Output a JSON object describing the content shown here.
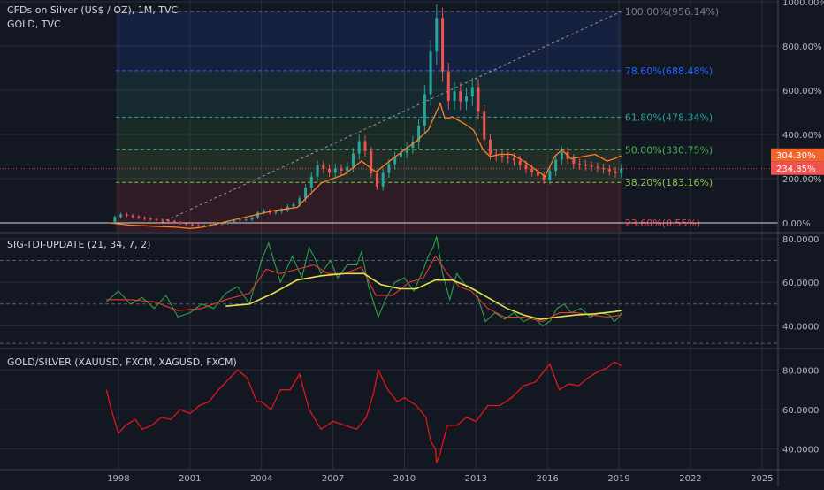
{
  "colors": {
    "background": "#131722",
    "grid": "#2a2e39",
    "silver_candle_up": "#26a69a",
    "silver_candle_down": "#ef5350",
    "gold_line": "#ff7f27",
    "tdi_green": "#2ea043",
    "tdi_red": "#e53935",
    "tdi_yellow": "#e6e04c",
    "ratio_line": "#e0171b",
    "badge_gold": "#f0642d",
    "badge_silver": "#ef5350"
  },
  "pane1": {
    "title": "CFDs on Silver (US$ / OZ), 1M, TVC",
    "subtitle": "GOLD, TVC",
    "badge_gold_value": "304.30%",
    "badge_silver_value": "234.85%"
  },
  "pane2": {
    "title": "SIG-TDI-UPDATE (21, 34, 7, 2)"
  },
  "pane3": {
    "title": "GOLD/SILVER (XAUUSD, FXCM, XAGUSD, FXCM)"
  },
  "chart_data": [
    {
      "type": "line",
      "name": "price-percent",
      "x_unit": "year",
      "xlim": [
        1996.0,
        2025.6
      ],
      "ylim": [
        -40,
        1000
      ],
      "y_ticks": [
        "0.00%",
        "200.00%",
        "400.00%",
        "600.00%",
        "800.00%",
        "1000.00%"
      ],
      "x_ticks": [
        "1998",
        "2001",
        "2004",
        "2007",
        "2010",
        "2013",
        "2016",
        "2019",
        "2022",
        "2025"
      ],
      "fibonacci_levels": [
        {
          "label": "100.00%(956.14%)",
          "value": 956.14,
          "color": "#787b86"
        },
        {
          "label": "78.60%(688.48%)",
          "value": 688.48,
          "color": "#2962ff"
        },
        {
          "label": "61.80%(478.34%)",
          "value": 478.34,
          "color": "#2ea09a"
        },
        {
          "label": "50.00%(330.75%)",
          "value": 330.75,
          "color": "#4caf50"
        },
        {
          "label": "38.20%(183.16%)",
          "value": 183.16,
          "color": "#8bc34a"
        },
        {
          "label": "23.60%(0.55%)",
          "value": 0.55,
          "color": "#f23645"
        }
      ],
      "series": [
        {
          "name": "CFDs on Silver (US$ / OZ)",
          "x": [
            1997.6,
            1998.0,
            1998.5,
            1999.0,
            1999.5,
            2000.0,
            2000.5,
            2001.0,
            2001.5,
            2002.0,
            2002.5,
            2003.0,
            2003.5,
            2004.0,
            2004.3,
            2004.8,
            2005.0,
            2005.5,
            2006.0,
            2006.4,
            2006.8,
            2007.0,
            2007.5,
            2008.0,
            2008.2,
            2008.5,
            2008.8,
            2009.0,
            2009.5,
            2010.0,
            2010.5,
            2010.8,
            2011.0,
            2011.2,
            2011.33,
            2011.5,
            2011.7,
            2011.9,
            2012.0,
            2012.2,
            2012.5,
            2012.75,
            2013.0,
            2013.3,
            2013.6,
            2014.0,
            2014.5,
            2015.0,
            2015.5,
            2015.9,
            2016.3,
            2016.6,
            2017.0,
            2017.5,
            2018.0,
            2018.5,
            2018.8,
            2019.0,
            2019.1
          ],
          "y": [
            5,
            40,
            30,
            20,
            15,
            10,
            0,
            -10,
            -15,
            -5,
            0,
            15,
            15,
            60,
            45,
            55,
            70,
            90,
            190,
            270,
            220,
            250,
            230,
            350,
            390,
            260,
            150,
            210,
            290,
            330,
            380,
            560,
            650,
            900,
            950,
            750,
            620,
            530,
            610,
            580,
            520,
            650,
            560,
            390,
            310,
            300,
            290,
            250,
            220,
            190,
            280,
            320,
            270,
            260,
            250,
            240,
            220,
            235,
            245
          ]
        },
        {
          "name": "GOLD",
          "x": [
            1997.6,
            1998.5,
            1999.5,
            2000.5,
            2001.0,
            2001.5,
            2002.5,
            2003.5,
            2004.5,
            2005.5,
            2006.5,
            2007.5,
            2008.2,
            2008.8,
            2009.5,
            2010.5,
            2011.0,
            2011.5,
            2011.7,
            2012.0,
            2012.5,
            2012.9,
            2013.3,
            2013.6,
            2014.0,
            2014.5,
            2015.0,
            2015.9,
            2016.3,
            2016.6,
            2017.0,
            2017.5,
            2018.0,
            2018.5,
            2018.8,
            2019.1
          ],
          "y": [
            0,
            -10,
            -15,
            -20,
            -25,
            -20,
            5,
            30,
            55,
            70,
            180,
            220,
            280,
            230,
            290,
            370,
            420,
            540,
            470,
            480,
            450,
            420,
            330,
            300,
            310,
            310,
            280,
            210,
            300,
            330,
            290,
            300,
            310,
            280,
            290,
            305
          ]
        }
      ]
    },
    {
      "type": "line",
      "name": "SIG-TDI-UPDATE (21, 34, 7, 2)",
      "x_unit": "year",
      "xlim": [
        1996.0,
        2025.6
      ],
      "ylim": [
        30,
        82
      ],
      "y_ticks": [
        "40.0000",
        "60.0000",
        "80.0000"
      ],
      "series": [
        {
          "name": "",
          "color": "green",
          "x": [
            1997.5,
            1998.0,
            1998.5,
            1999.0,
            1999.5,
            2000.0,
            2000.5,
            2001.0,
            2001.5,
            2002.0,
            2002.5,
            2003.0,
            2003.5,
            2004.0,
            2004.3,
            2004.8,
            2005.3,
            2005.7,
            2006.0,
            2006.2,
            2006.5,
            2006.9,
            2007.2,
            2007.6,
            2008.0,
            2008.2,
            2008.5,
            2008.9,
            2009.2,
            2009.6,
            2010.0,
            2010.4,
            2010.8,
            2011.0,
            2011.2,
            2011.35,
            2011.6,
            2011.9,
            2012.2,
            2012.6,
            2013.0,
            2013.4,
            2013.8,
            2014.2,
            2014.6,
            2015.0,
            2015.4,
            2015.8,
            2016.1,
            2016.4,
            2016.7,
            2017.0,
            2017.4,
            2017.8,
            2018.2,
            2018.6,
            2018.8,
            2019.0,
            2019.1
          ],
          "y": [
            51,
            56,
            50,
            53,
            48,
            54,
            44,
            46,
            50,
            48,
            55,
            58,
            50,
            70,
            78,
            60,
            72,
            62,
            76,
            72,
            64,
            70,
            62,
            68,
            68,
            74,
            58,
            44,
            52,
            60,
            62,
            56,
            66,
            72,
            76,
            81,
            64,
            52,
            64,
            58,
            56,
            42,
            46,
            43,
            46,
            42,
            44,
            40,
            42,
            48,
            50,
            46,
            48,
            44,
            46,
            45,
            42,
            44,
            46
          ]
        },
        {
          "name": "",
          "color": "red",
          "x": [
            1997.5,
            1998.5,
            1999.5,
            2000.5,
            2001.5,
            2002.5,
            2003.5,
            2004.2,
            2004.8,
            2005.5,
            2006.2,
            2006.8,
            2007.5,
            2008.2,
            2008.8,
            2009.5,
            2010.2,
            2010.8,
            2011.3,
            2011.8,
            2012.3,
            2012.8,
            2013.5,
            2014.2,
            2015.0,
            2015.8,
            2016.5,
            2017.2,
            2017.8,
            2018.5,
            2019.1
          ],
          "y": [
            52,
            52,
            51,
            47,
            48,
            52,
            55,
            66,
            64,
            66,
            68,
            64,
            64,
            67,
            54,
            54,
            60,
            62,
            72,
            64,
            58,
            56,
            48,
            44,
            44,
            42,
            46,
            46,
            45,
            44,
            45
          ]
        },
        {
          "name": "",
          "color": "yellow",
          "x": [
            2002.5,
            2003.5,
            2004.5,
            2005.5,
            2006.5,
            2007.5,
            2008.3,
            2009.0,
            2009.8,
            2010.5,
            2011.3,
            2012.0,
            2012.7,
            2013.5,
            2014.3,
            2015.0,
            2015.7,
            2016.4,
            2017.2,
            2018.0,
            2018.8,
            2019.1
          ],
          "y": [
            49,
            50,
            55,
            61,
            63,
            64,
            64,
            59,
            57,
            57,
            61,
            61,
            58,
            53,
            48,
            45,
            43,
            44,
            45,
            45.5,
            46.5,
            47
          ]
        }
      ]
    },
    {
      "type": "line",
      "name": "GOLD/SILVER (XAUUSD, FXCM, XAGUSD, FXCM)",
      "x_unit": "year",
      "xlim": [
        1996.0,
        2025.6
      ],
      "ylim": [
        30,
        90
      ],
      "y_ticks": [
        "40.0000",
        "60.0000",
        "80.0000"
      ],
      "series": [
        {
          "name": "GOLD/SILVER",
          "x": [
            1997.5,
            1997.7,
            1998.0,
            1998.3,
            1998.7,
            1999.0,
            1999.4,
            1999.8,
            2000.2,
            2000.6,
            2001.0,
            2001.4,
            2001.8,
            2002.2,
            2002.6,
            2003.0,
            2003.4,
            2003.8,
            2004.0,
            2004.4,
            2004.8,
            2005.2,
            2005.6,
            2006.0,
            2006.5,
            2007.0,
            2007.5,
            2008.0,
            2008.4,
            2008.7,
            2008.9,
            2009.3,
            2009.7,
            2010.0,
            2010.5,
            2010.9,
            2011.1,
            2011.3,
            2011.35,
            2011.5,
            2011.8,
            2012.2,
            2012.6,
            2013.0,
            2013.5,
            2014.0,
            2014.5,
            2015.0,
            2015.5,
            2015.9,
            2016.1,
            2016.5,
            2016.9,
            2017.3,
            2017.7,
            2018.1,
            2018.5,
            2018.8,
            2019.0,
            2019.1
          ],
          "y": [
            70,
            60,
            48,
            52,
            55,
            50,
            52,
            56,
            55,
            60,
            58,
            62,
            64,
            70,
            75,
            80,
            76,
            64,
            64,
            60,
            70,
            70,
            78,
            60,
            50,
            54,
            52,
            50,
            56,
            68,
            80,
            70,
            64,
            66,
            62,
            56,
            44,
            40,
            33,
            38,
            52,
            52,
            56,
            54,
            62,
            62,
            66,
            72,
            74,
            80,
            83,
            70,
            73,
            72,
            76,
            79,
            81,
            84,
            83,
            82
          ]
        }
      ]
    }
  ]
}
